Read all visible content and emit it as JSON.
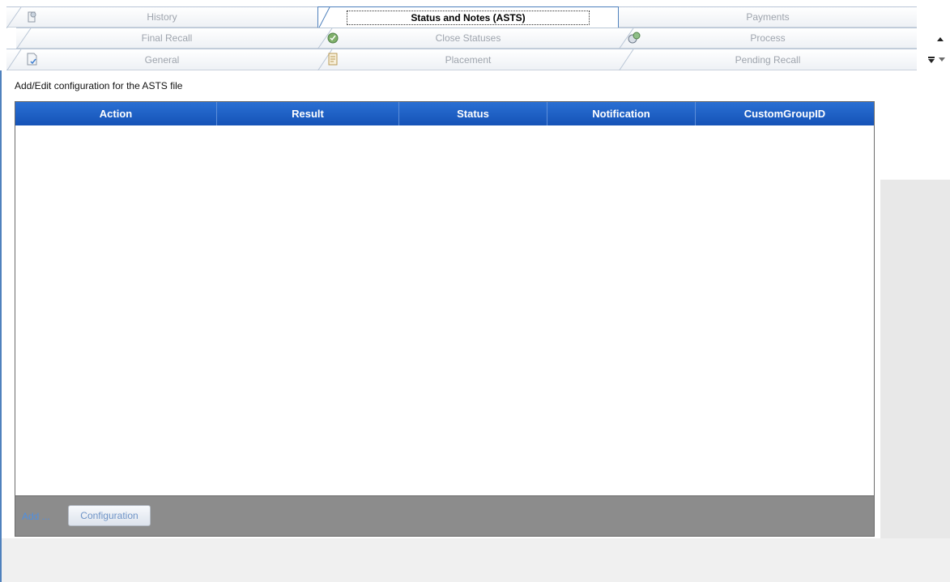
{
  "tabs": {
    "row1": [
      {
        "label": "History",
        "icon": "history-icon"
      },
      {
        "label": "Status and Notes (ASTS)",
        "selected": true
      },
      {
        "label": "Payments"
      }
    ],
    "row2": [
      {
        "label": "Final Recall"
      },
      {
        "label": "Close Statuses",
        "icon": "close-statuses-icon"
      },
      {
        "label": "Process",
        "icon": "process-icon"
      }
    ],
    "row3": [
      {
        "label": "General",
        "icon": "general-icon"
      },
      {
        "label": "Placement",
        "icon": "placement-icon"
      },
      {
        "label": "Pending Recall"
      }
    ]
  },
  "panel": {
    "caption": "Add/Edit configuration for the ASTS file"
  },
  "grid": {
    "columns": [
      "Action",
      "Result",
      "Status",
      "Notification",
      "CustomGroupID"
    ],
    "rows": []
  },
  "footer": {
    "add_label": "Add ...",
    "configuration_label": "Configuration"
  },
  "colors": {
    "header_blue": "#1a5ec8",
    "accent_border": "#4f81bd",
    "footer_gray": "#8c8c8c"
  }
}
